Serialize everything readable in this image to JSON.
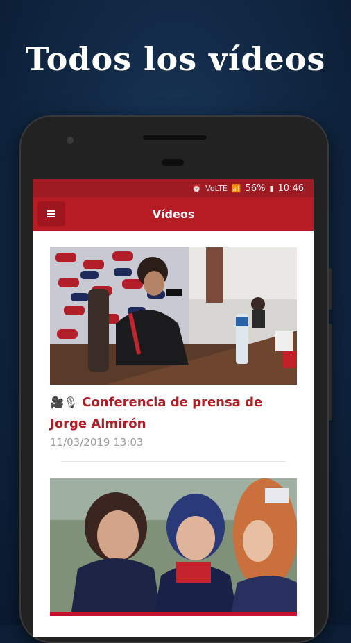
{
  "promo": {
    "headline": "Todos los vídeos"
  },
  "status_bar": {
    "signal": "VoLTE",
    "battery_percent": "56%",
    "time": "10:46"
  },
  "app_bar": {
    "title": "Vídeos",
    "menu_icon": "hamburger-menu-icon"
  },
  "videos": [
    {
      "icons": "🎥🎙",
      "title": "Conferencia de prensa de Jorge Almirón",
      "date": "11/03/2019 13:03"
    },
    {
      "icons": "",
      "title": "",
      "date": ""
    }
  ],
  "colors": {
    "brand_red": "#b71c25",
    "status_red": "#9e1b23",
    "background_navy": "#122a47"
  }
}
